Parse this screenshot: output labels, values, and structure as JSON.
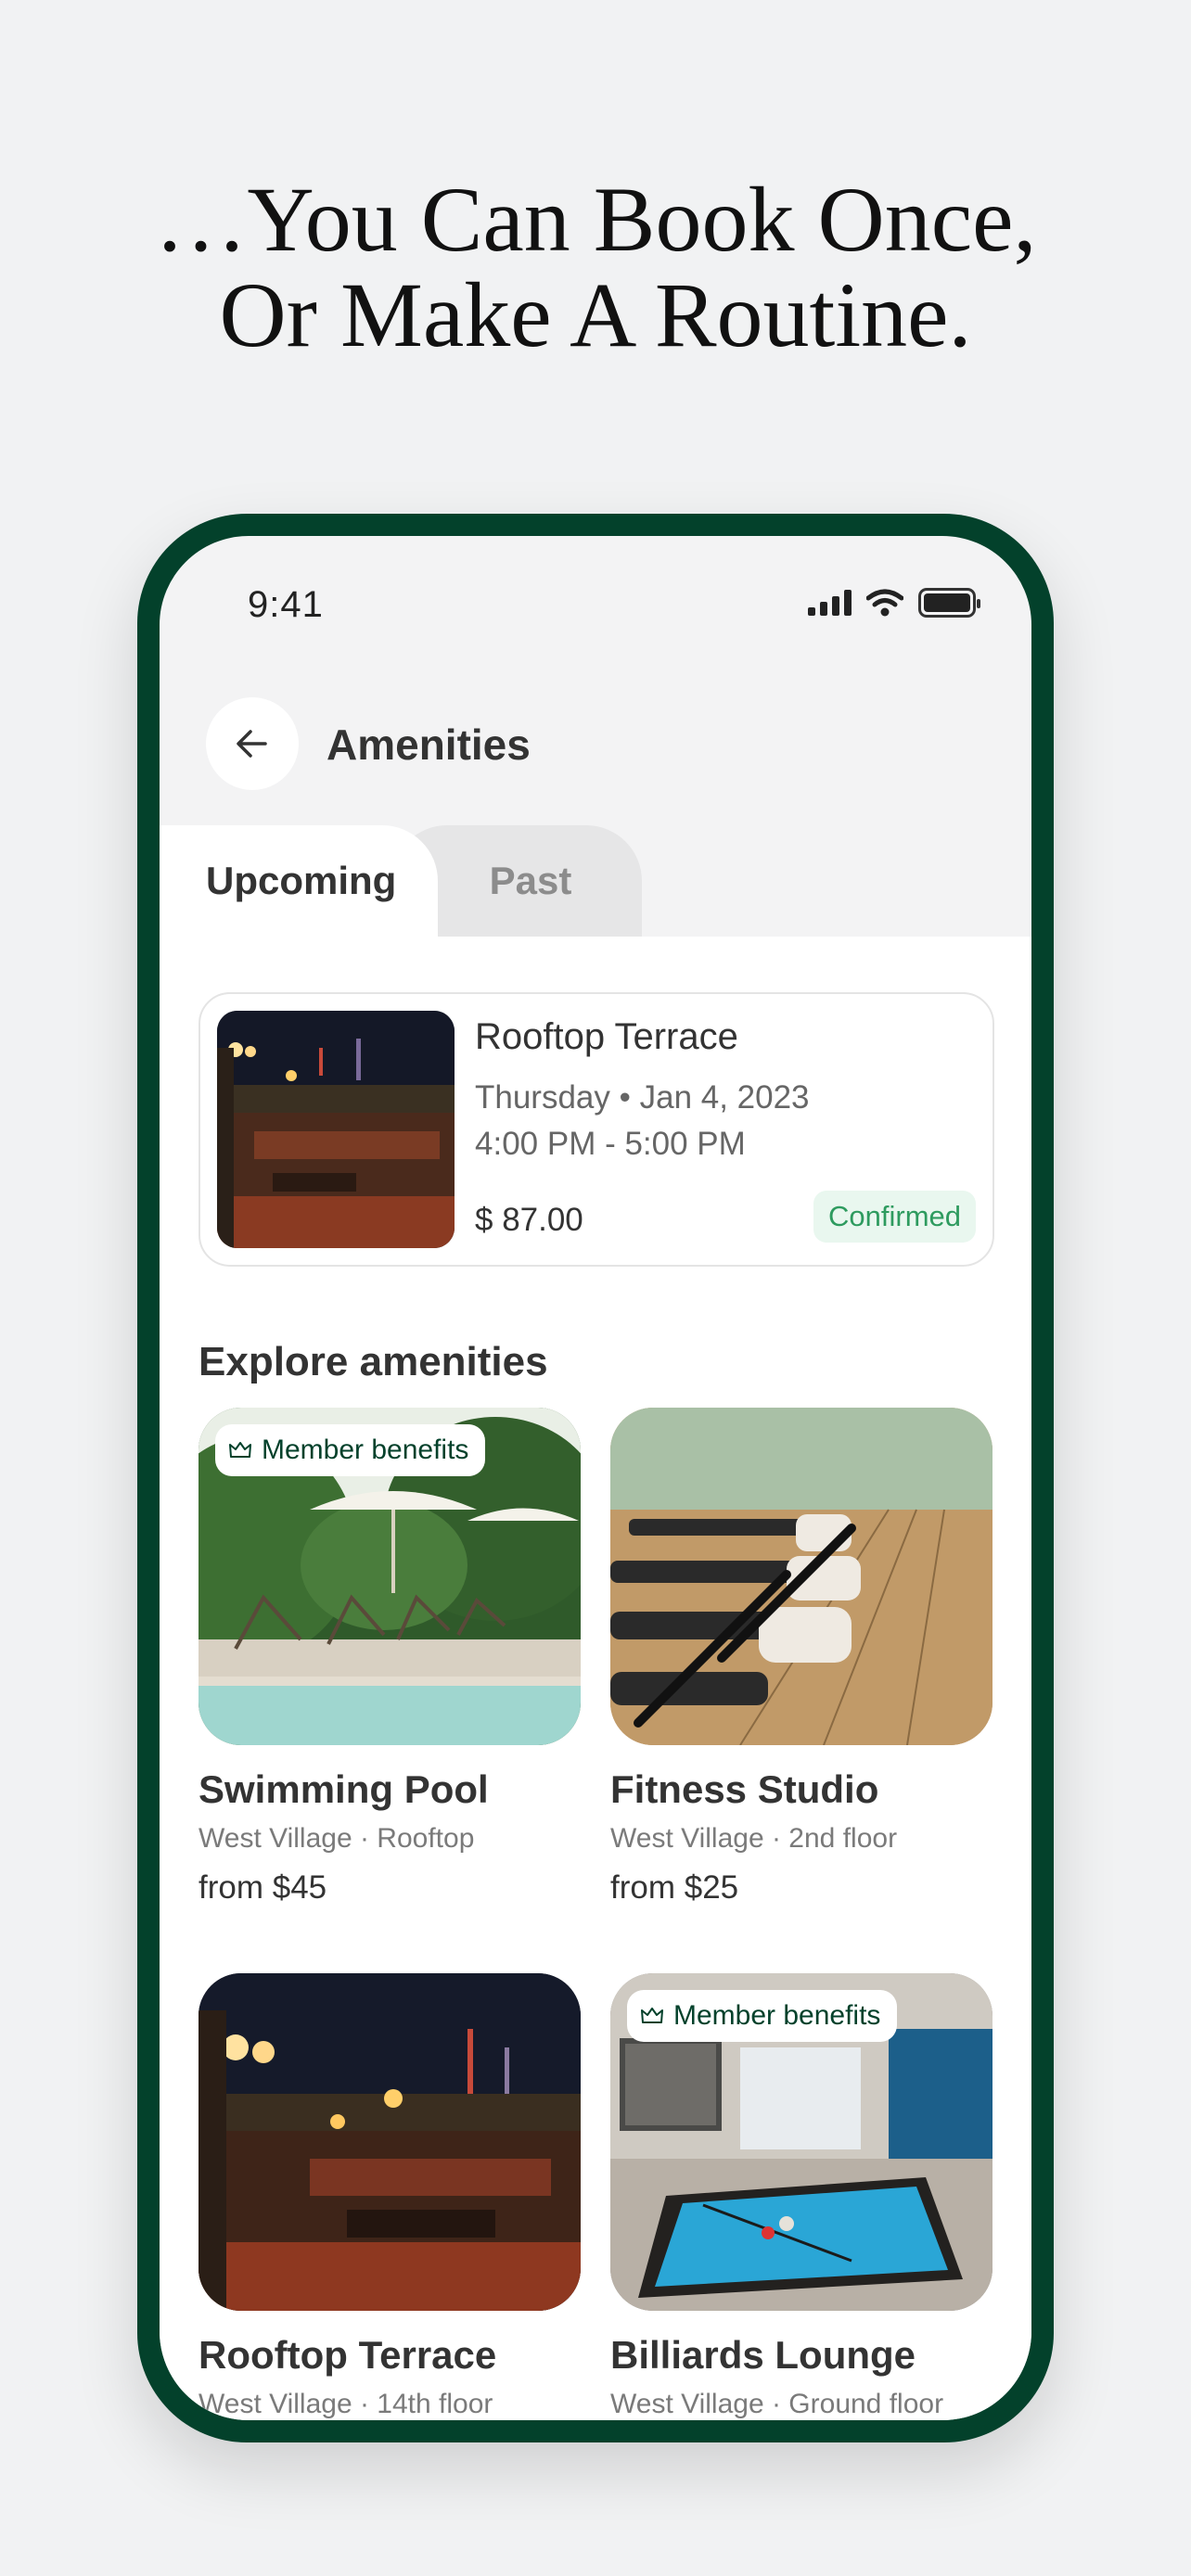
{
  "headline": {
    "line1": "…You Can Book Once,",
    "line2": "Or Make A Routine."
  },
  "status_bar": {
    "time": "9:41",
    "icons": [
      "cellular-signal-icon",
      "wifi-icon",
      "battery-icon"
    ]
  },
  "header": {
    "back_icon": "arrow-left-icon",
    "title": "Amenities"
  },
  "tabs": [
    {
      "label": "Upcoming",
      "selected": true
    },
    {
      "label": "Past",
      "selected": false
    }
  ],
  "booking": {
    "name": "Rooftop Terrace",
    "date": "Thursday • Jan 4, 2023",
    "time": "4:00 PM - 5:00 PM",
    "price": "$ 87.00",
    "status": "Confirmed"
  },
  "explore": {
    "title": "Explore amenities",
    "items": [
      {
        "name": "Swimming Pool",
        "location": "West Village · Rooftop",
        "price": "from $45",
        "badge": "Member benefits"
      },
      {
        "name": "Fitness Studio",
        "location": "West Village · 2nd floor",
        "price": "from $25",
        "badge": ""
      },
      {
        "name": "Rooftop Terrace",
        "location": "West Village · 14th floor",
        "price": "",
        "badge": ""
      },
      {
        "name": "Billiards Lounge",
        "location": "West Village · Ground floor",
        "price": "",
        "badge": "Member benefits"
      }
    ]
  },
  "colors": {
    "brand_green": "#03412b",
    "confirmed_text": "#2e9b5f",
    "confirmed_bg": "#e9f7ef",
    "background": "#f1f2f3"
  }
}
